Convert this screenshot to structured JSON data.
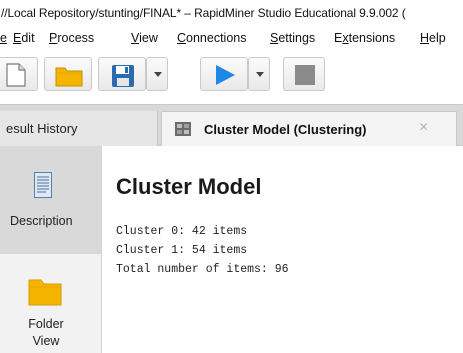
{
  "window": {
    "title": "//Local Repository/stunting/FINAL* – RapidMiner Studio Educational 9.9.002 ("
  },
  "menu": {
    "items": [
      {
        "pre": "",
        "mn": "e",
        "post": ""
      },
      {
        "pre": "",
        "mn": "E",
        "post": "dit"
      },
      {
        "pre": "",
        "mn": "P",
        "post": "rocess"
      },
      {
        "pre": "",
        "mn": "V",
        "post": "iew"
      },
      {
        "pre": "",
        "mn": "C",
        "post": "onnections"
      },
      {
        "pre": "",
        "mn": "S",
        "post": "ettings"
      },
      {
        "pre": "E",
        "mn": "x",
        "post": "tensions"
      },
      {
        "pre": "",
        "mn": "H",
        "post": "elp"
      }
    ]
  },
  "toolbar": {
    "icons": [
      "new-process-icon",
      "open-folder-icon",
      "save-icon",
      "run-icon",
      "stop-icon"
    ],
    "colors": {
      "run": "#1e88e5",
      "folder": "#f4b400",
      "save": "#2b6cb0",
      "stop": "#8a8a8a"
    }
  },
  "tabs": {
    "history_label": "esult History",
    "active_label": "Cluster Model (Clustering)",
    "close_glyph": "×"
  },
  "sidebar": {
    "description_label": "Description",
    "folder_label_line1": "Folder",
    "folder_label_line2": "View"
  },
  "content": {
    "heading": "Cluster Model",
    "lines": [
      "Cluster 0: 42 items",
      "Cluster 1: 54 items",
      "Total number of items: 96"
    ]
  }
}
